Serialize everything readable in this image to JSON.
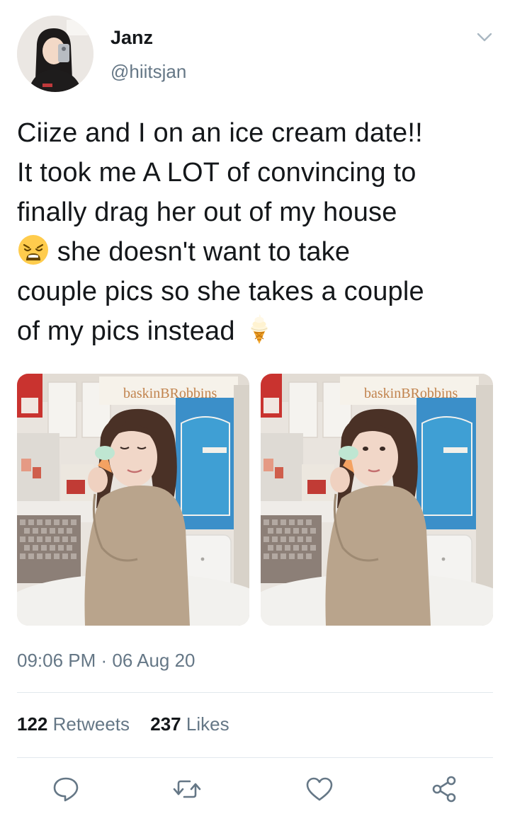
{
  "user": {
    "name": "Janz",
    "handle": "@hiitsjan"
  },
  "tweet": {
    "lines": [
      "Ciize and I on an ice cream date!!",
      "It took me A LOT of convincing to",
      "finally drag her out of my house",
      " she doesn't want to take",
      "couple pics so she takes a couple",
      "of my pics instead "
    ],
    "emojis": [
      "weary-face-icon",
      "soft-ice-cream-icon"
    ]
  },
  "media": {
    "count": 2,
    "store_sign": "baskinBRobbins"
  },
  "timestamp": "09:06 PM · 06 Aug 20",
  "stats": {
    "retweets_count": "122",
    "retweets_label": "Retweets",
    "likes_count": "237",
    "likes_label": "Likes"
  },
  "actions": [
    "reply-icon",
    "retweet-icon",
    "like-icon",
    "share-icon"
  ],
  "colors": {
    "text": "#14171a",
    "secondary": "#657786",
    "divider": "#e1e8ed"
  }
}
